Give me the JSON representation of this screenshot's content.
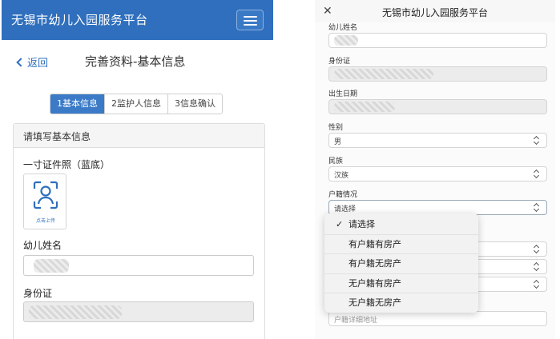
{
  "left": {
    "header_title": "无锡市幼儿入园服务平台",
    "back_label": "返回",
    "page_title": "完善资料-基本信息",
    "steps": [
      {
        "label": "1基本信息",
        "active": true
      },
      {
        "label": "2监护人信息",
        "active": false
      },
      {
        "label": "3信息确认",
        "active": false
      }
    ],
    "panel_title": "请填写基本信息",
    "photo_label": "一寸证件照（蓝底）",
    "photo_upload": "点击上传",
    "child_name_label": "幼儿姓名",
    "id_label": "身份证"
  },
  "right": {
    "title": "无锡市幼儿入园服务平台",
    "close_icon": "close-icon",
    "child_name_label": "幼儿姓名",
    "id_label": "身份证",
    "birth_label": "出生日期",
    "gender_label": "性别",
    "gender_value": "男",
    "ethnicity_label": "民族",
    "ethnicity_value": "汉族",
    "household_label": "户籍情况",
    "household_value": "请选择",
    "address_placeholder": "户籍详细地址",
    "dropdown_options": [
      "请选择",
      "有户籍有房产",
      "有户籍无房产",
      "无户籍有房产",
      "无户籍无房产"
    ],
    "dropdown_selected": "请选择"
  },
  "colors": {
    "brand_blue": "#2f6fbd",
    "active_step": "#3a7ac7"
  }
}
